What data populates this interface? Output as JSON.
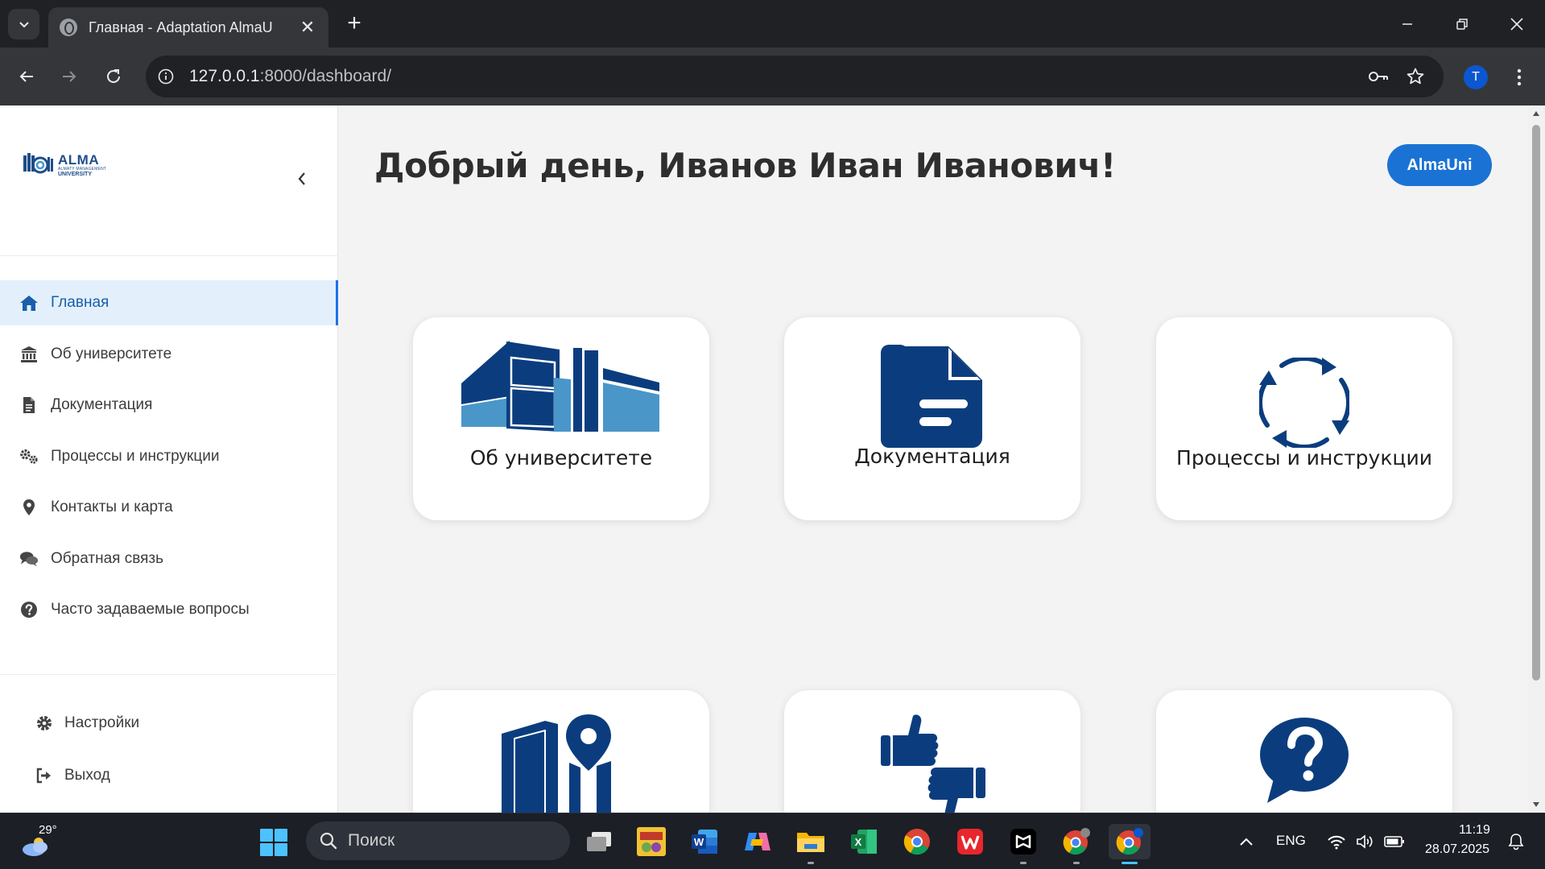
{
  "browser": {
    "tab_title": "Главная - Adaptation AlmaU",
    "url_host": "127.0.0.1",
    "url_path": ":8000/dashboard/",
    "profile_initial": "T"
  },
  "sidebar": {
    "logo": {
      "line1": "ALMA",
      "line2": "ALMATY MANAGEMENT",
      "line3": "UNIVERSITY"
    },
    "items": [
      {
        "label": "Главная",
        "icon": "home-icon",
        "active": true
      },
      {
        "label": "Об университете",
        "icon": "institution-icon",
        "active": false
      },
      {
        "label": "Документация",
        "icon": "file-icon",
        "active": false
      },
      {
        "label": "Процессы и инструкции",
        "icon": "cogs-icon",
        "active": false
      },
      {
        "label": "Контакты и карта",
        "icon": "map-marker-icon",
        "active": false
      },
      {
        "label": "Обратная связь",
        "icon": "comments-icon",
        "active": false
      },
      {
        "label": "Часто задаваемые вопросы",
        "icon": "question-circle-icon",
        "active": false
      }
    ],
    "bottom": [
      {
        "label": "Настройки",
        "icon": "gear-icon"
      },
      {
        "label": "Выход",
        "icon": "sign-out-icon"
      }
    ]
  },
  "main": {
    "greeting": "Добрый день, Иванов Иван Иванович!",
    "brand_button": "AlmaUni",
    "cards": [
      {
        "label": "Об университете",
        "icon": "building-icon"
      },
      {
        "label": "Документация",
        "icon": "document-icon"
      },
      {
        "label": "Процессы и инструкции",
        "icon": "sync-icon"
      },
      {
        "label": "",
        "icon": "map-door-icon"
      },
      {
        "label": "",
        "icon": "thumbs-feedback-icon"
      },
      {
        "label": "",
        "icon": "question-bubble-icon"
      }
    ]
  },
  "taskbar": {
    "temperature": "29°",
    "search_placeholder": "Поиск",
    "language": "ENG",
    "time": "11:19",
    "date": "28.07.2025"
  },
  "colors": {
    "primary": "#1a73d4",
    "icon_dark": "#0b3d7e",
    "icon_light": "#4a96c9",
    "active_bg": "#e3f0fc"
  }
}
